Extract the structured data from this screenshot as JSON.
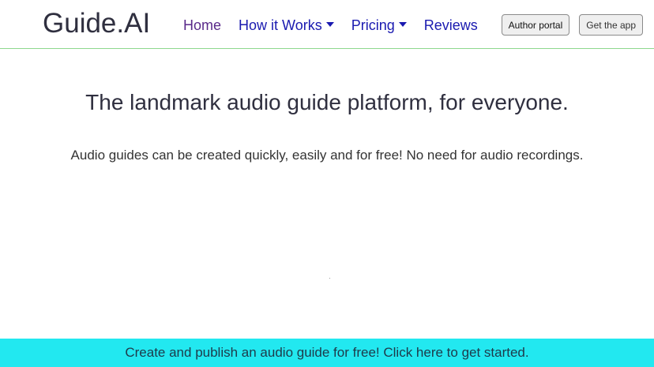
{
  "header": {
    "brand": "Guide.AI",
    "nav": [
      {
        "label": "Home"
      },
      {
        "label": "How it Works"
      },
      {
        "label": "Pricing"
      },
      {
        "label": "Reviews"
      }
    ],
    "buttons": {
      "author_portal": "Author portal",
      "get_app": "Get the app"
    }
  },
  "hero": {
    "title": "The landmark audio guide platform, for everyone.",
    "subtitle": "Audio guides can be created quickly, easily and for free! No need for audio recordings."
  },
  "cta": {
    "text": "Create and publish an audio guide for free! Click here to get started."
  },
  "colors": {
    "nav_link": "#1a1ab0",
    "nav_link_visited": "#5a2a8a",
    "header_border": "#8ed88e",
    "cta_background": "#22e8f0"
  },
  "icons": {
    "dropdown": "caret-down-icon"
  }
}
